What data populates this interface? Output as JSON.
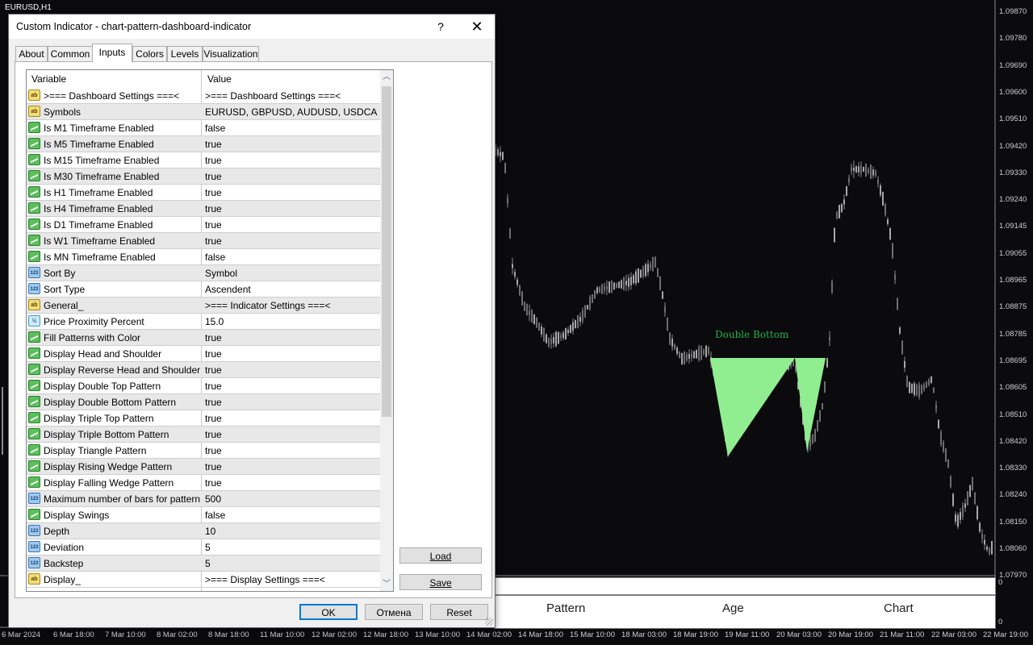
{
  "chart": {
    "symbol_label": "EURUSD,H1",
    "pattern_annotation": "Double Bottom",
    "price_scale": [
      "1.09870",
      "1.09780",
      "1.09690",
      "1.09600",
      "1.09510",
      "1.09420",
      "1.09330",
      "1.09240",
      "1.09145",
      "1.09055",
      "1.08965",
      "1.08875",
      "1.08785",
      "1.08695",
      "1.08605",
      "1.08510",
      "1.08420",
      "1.08330",
      "1.08240",
      "1.08150",
      "1.08060",
      "1.07970"
    ],
    "time_scale": [
      "6 Mar 2024",
      "6 Mar 18:00",
      "7 Mar 10:00",
      "8 Mar 02:00",
      "8 Mar 18:00",
      "11 Mar 10:00",
      "12 Mar 02:00",
      "12 Mar 18:00",
      "13 Mar 10:00",
      "14 Mar 02:00",
      "14 Mar 18:00",
      "15 Mar 10:00",
      "18 Mar 03:00",
      "18 Mar 19:00",
      "19 Mar 11:00",
      "20 Mar 03:00",
      "20 Mar 19:00",
      "21 Mar 11:00",
      "22 Mar 03:00",
      "22 Mar 19:00"
    ],
    "subwindow_scale": [
      "0",
      "0"
    ],
    "colors": {
      "background": "#0b0b0e",
      "candle": "#9a9a9a",
      "pattern_fill": "#90ee90",
      "pattern_text": "#22b04a"
    }
  },
  "dashboard": {
    "headers": [
      "Pattern",
      "Age",
      "Chart"
    ]
  },
  "dialog": {
    "title": "Custom Indicator - chart-pattern-dashboard-indicator",
    "help_label": "?",
    "close_label": "✕",
    "tabs": [
      "About",
      "Common",
      "Inputs",
      "Colors",
      "Levels",
      "Visualization"
    ],
    "active_tab": "Inputs",
    "grid": {
      "col_variable": "Variable",
      "col_value": "Value",
      "rows": [
        {
          "type": "ab",
          "var": ">=== Dashboard Settings ===<",
          "val": ">=== Dashboard Settings ===<"
        },
        {
          "type": "ab",
          "var": "Symbols",
          "val": "EURUSD, GBPUSD, AUDUSD, USDCAD..."
        },
        {
          "type": "bool",
          "var": "Is M1 Timeframe Enabled",
          "val": "false"
        },
        {
          "type": "bool",
          "var": "Is M5 Timeframe Enabled",
          "val": "true"
        },
        {
          "type": "bool",
          "var": "Is M15 Timeframe Enabled",
          "val": "true"
        },
        {
          "type": "bool",
          "var": "Is M30 Timeframe Enabled",
          "val": "true"
        },
        {
          "type": "bool",
          "var": "Is H1 Timeframe Enabled",
          "val": "true"
        },
        {
          "type": "bool",
          "var": "Is H4 Timeframe Enabled",
          "val": "true"
        },
        {
          "type": "bool",
          "var": "Is D1 Timeframe Enabled",
          "val": "true"
        },
        {
          "type": "bool",
          "var": "Is W1 Timeframe Enabled",
          "val": "true"
        },
        {
          "type": "bool",
          "var": "Is MN Timeframe Enabled",
          "val": "false"
        },
        {
          "type": "n123",
          "var": "Sort By",
          "val": "Symbol"
        },
        {
          "type": "n123",
          "var": "Sort Type",
          "val": "Ascendent"
        },
        {
          "type": "ab",
          "var": "General_",
          "val": ">=== Indicator Settings ===<"
        },
        {
          "type": "half",
          "var": "Price Proximity Percent",
          "val": "15.0"
        },
        {
          "type": "bool",
          "var": "Fill Patterns with Color",
          "val": "true"
        },
        {
          "type": "bool",
          "var": "Display Head and Shoulder",
          "val": "true"
        },
        {
          "type": "bool",
          "var": "Display Reverse Head and Shoulder P...",
          "val": "true"
        },
        {
          "type": "bool",
          "var": "Display Double Top Pattern",
          "val": "true"
        },
        {
          "type": "bool",
          "var": "Display Double Bottom Pattern",
          "val": "true"
        },
        {
          "type": "bool",
          "var": "Display Triple Top Pattern",
          "val": "true"
        },
        {
          "type": "bool",
          "var": "Display Triple Bottom Pattern",
          "val": "true"
        },
        {
          "type": "bool",
          "var": "Display Triangle Pattern",
          "val": "true"
        },
        {
          "type": "bool",
          "var": "Display Rising Wedge Pattern",
          "val": "true"
        },
        {
          "type": "bool",
          "var": "Display Falling Wedge Pattern",
          "val": "true"
        },
        {
          "type": "n123",
          "var": "Maximum number of bars for patterns s...",
          "val": "500"
        },
        {
          "type": "bool",
          "var": "Display Swings",
          "val": "false"
        },
        {
          "type": "n123",
          "var": "Depth",
          "val": "10"
        },
        {
          "type": "n123",
          "var": "Deviation",
          "val": "5"
        },
        {
          "type": "n123",
          "var": "Backstep",
          "val": "5"
        },
        {
          "type": "ab",
          "var": "Display_",
          "val": ">=== Display Settings ===<"
        }
      ]
    },
    "buttons": {
      "load": "Load",
      "save": "Save",
      "ok": "OK",
      "cancel": "Отмена",
      "reset": "Reset"
    }
  }
}
